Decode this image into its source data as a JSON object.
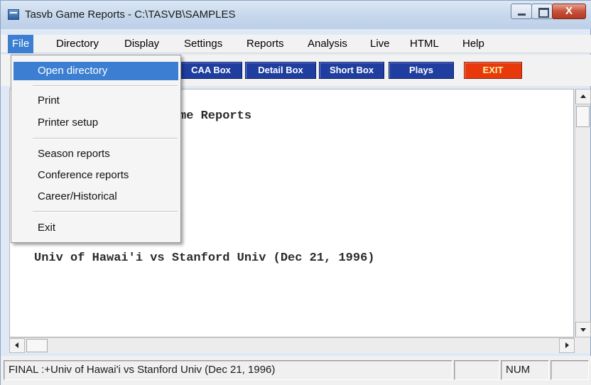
{
  "window": {
    "title": "Tasvb Game Reports - C:\\TASVB\\SAMPLES",
    "close_glyph": "X"
  },
  "menubar": {
    "items": [
      {
        "label": "File"
      },
      {
        "label": "Directory"
      },
      {
        "label": "Display"
      },
      {
        "label": "Settings"
      },
      {
        "label": "Reports"
      },
      {
        "label": "Analysis"
      },
      {
        "label": "Live"
      },
      {
        "label": "HTML"
      },
      {
        "label": "Help"
      }
    ]
  },
  "toolbar": {
    "buttons": [
      {
        "label": "CAA Box"
      },
      {
        "label": "Detail Box"
      },
      {
        "label": "Short Box"
      },
      {
        "label": "Plays"
      },
      {
        "label": "EXIT"
      }
    ]
  },
  "file_menu": {
    "items": [
      {
        "label": "Open directory"
      },
      {
        "label": "Print"
      },
      {
        "label": "Printer setup"
      },
      {
        "label": "Season reports"
      },
      {
        "label": "Conference reports"
      },
      {
        "label": "Career/Historical"
      },
      {
        "label": "Exit"
      }
    ]
  },
  "document": {
    "lines": [
      {
        "text": "me Reports"
      },
      {
        "text": "Univ of Hawai'i vs Stanford Univ (Dec 21, 1996)"
      }
    ]
  },
  "statusbar": {
    "main_text": "FINAL  :+Univ of Hawai'i vs Stanford Univ (Dec 21, 1996)",
    "empty_pane": "",
    "num_indicator": "NUM",
    "last_pane": ""
  },
  "colors": {
    "menu_highlight": "#3c7fd2",
    "toolbar_button": "#1f3ea0",
    "exit_button": "#e8390c"
  }
}
